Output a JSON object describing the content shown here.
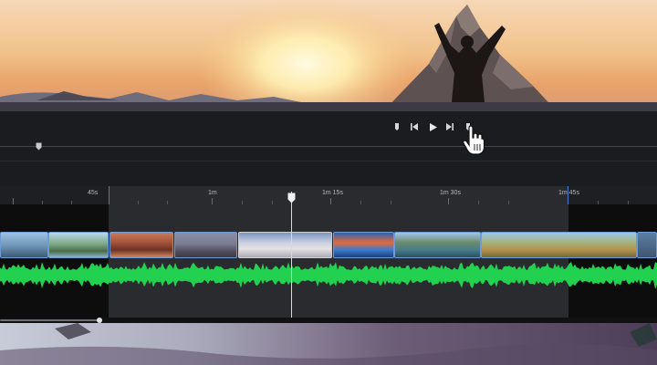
{
  "preview": {
    "description_icon": "mountain-summit-photo"
  },
  "controls": {
    "icons": [
      "mark-in-icon",
      "skip-back-icon",
      "play-icon",
      "skip-forward-icon",
      "mark-out-icon"
    ]
  },
  "ruler": {
    "labels": [
      "45s",
      "1m",
      "1m 15s",
      "1m 30s",
      "1m 45s"
    ]
  },
  "timeline": {
    "selection_color": "#2a2b2e",
    "clip_border_color": "#6e9ad6",
    "audio_color": "#21d14f",
    "playhead_color": "#d9d9dc"
  }
}
